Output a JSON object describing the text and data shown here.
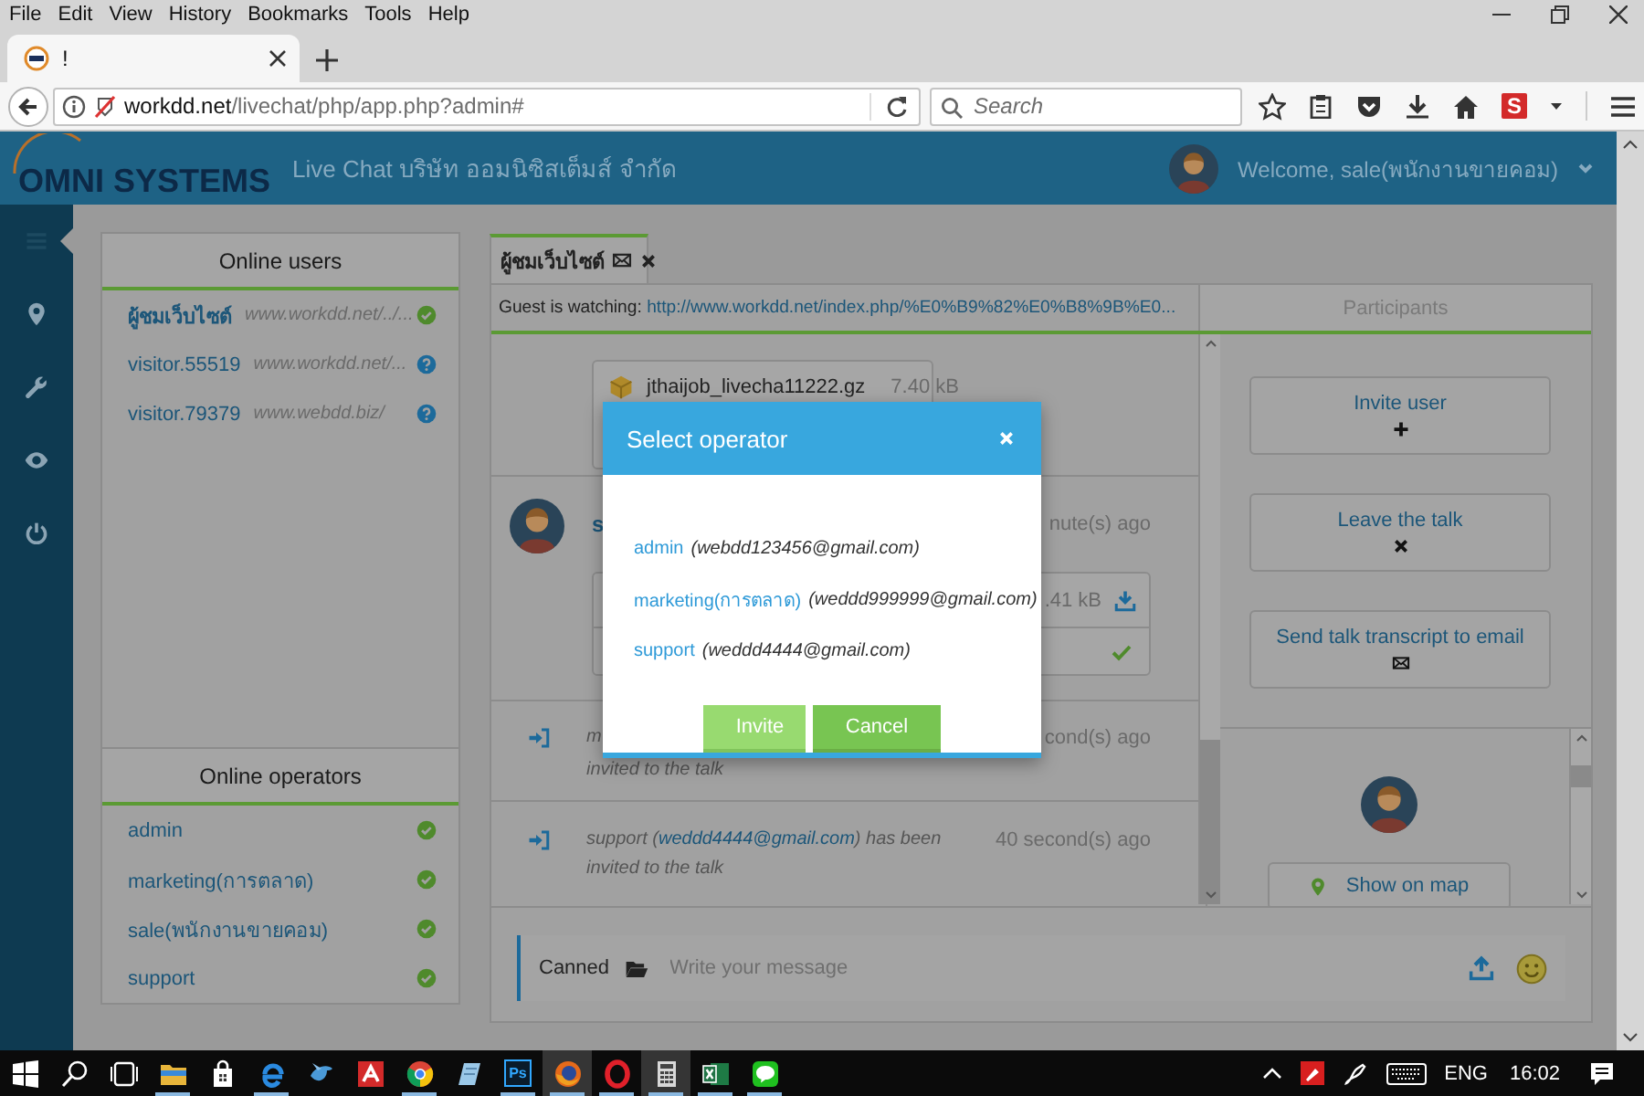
{
  "browser": {
    "menu": [
      "File",
      "Edit",
      "View",
      "History",
      "Bookmarks",
      "Tools",
      "Help"
    ],
    "tab_title": "!",
    "url": {
      "host": "workdd.net",
      "path": "/livechat/php/app.php?admin#"
    },
    "search": {
      "placeholder": "Search"
    },
    "extension_label": "S"
  },
  "header": {
    "logo": "OMNI SYSTEMS",
    "title": "Live Chat บริษัท ออมนิซิสเต็มส์ จำกัด",
    "welcome": "Welcome, sale(พนักงานขายคอม)"
  },
  "sidebar": {
    "items": [
      {
        "kind": "menu",
        "selected": true
      },
      {
        "kind": "pin",
        "selected": false
      },
      {
        "kind": "wrench",
        "selected": false
      },
      {
        "kind": "eye",
        "selected": false
      },
      {
        "kind": "power",
        "selected": false
      }
    ]
  },
  "online_users": {
    "title": "Online users",
    "items": [
      {
        "kind": "online",
        "name": "ผู้ชมเว็บไซต์",
        "page": "www.workdd.net/../...",
        "selected": true
      },
      {
        "kind": "unknown",
        "name": "visitor.55519",
        "page": "www.workdd.net/...",
        "selected": false
      },
      {
        "kind": "unknown",
        "name": "visitor.79379",
        "page": "www.webdd.biz/",
        "selected": false
      }
    ]
  },
  "online_operators": {
    "title": "Online operators",
    "items": [
      {
        "kind": "online",
        "name": "admin"
      },
      {
        "kind": "online",
        "name": "marketing(การตลาด)"
      },
      {
        "kind": "online",
        "name": "sale(พนักงานขายคอม)"
      },
      {
        "kind": "online",
        "name": "support"
      }
    ]
  },
  "chat": {
    "tab": {
      "label": "ผู้ชมเว็บไซต์",
      "selected": true
    },
    "watching": {
      "label": "Guest is watching:",
      "url": "http://www.workdd.net/index.php/%E0%B9%82%E0%B8%9B%E0..."
    },
    "messages": [
      {
        "kind": "file",
        "file": "jthaijob_livecha11222.gz",
        "size": "7.40 kB"
      },
      {
        "kind": "message",
        "author": "s",
        "time": "nute(s) ago",
        "size": ".41 kB",
        "delivered": true
      },
      {
        "kind": "system",
        "text": "m",
        "continued": "invited to the talk",
        "time": "cond(s) ago"
      },
      {
        "kind": "system",
        "text": "support (",
        "link": "weddd4444@gmail.com",
        "after": ") has been invited to the talk",
        "time": "40 second(s) ago"
      }
    ],
    "composer": {
      "canned": "Canned",
      "placeholder": "Write your message"
    }
  },
  "participants": {
    "title": "Participants",
    "actions": [
      {
        "kind": "plus",
        "label": "Invite user"
      },
      {
        "kind": "close",
        "label": "Leave the talk"
      },
      {
        "kind": "mail",
        "label": "Send talk transcript to email"
      }
    ],
    "map_button": "Show on map"
  },
  "dialog": {
    "title": "Select operator",
    "operators": [
      {
        "name": "admin",
        "email": "(webdd123456@gmail.com)"
      },
      {
        "name": "marketing(การตลาด)",
        "email": "(weddd999999@gmail.com)"
      },
      {
        "name": "support",
        "email": "(weddd4444@gmail.com)"
      }
    ],
    "buttons": [
      {
        "label": "Invite",
        "disabled": true
      },
      {
        "label": "Cancel",
        "disabled": false
      }
    ]
  },
  "taskbar": {
    "apps": [
      {
        "kind": "start",
        "running": false,
        "selected": false
      },
      {
        "kind": "search",
        "running": false,
        "selected": false
      },
      {
        "kind": "taskview",
        "running": false,
        "selected": false
      },
      {
        "kind": "folder",
        "running": true,
        "selected": false
      },
      {
        "kind": "store",
        "running": false,
        "selected": false
      },
      {
        "kind": "edge",
        "running": true,
        "selected": false
      },
      {
        "kind": "bird",
        "running": false,
        "selected": false
      },
      {
        "kind": "avira",
        "running": false,
        "selected": false
      },
      {
        "kind": "chrome",
        "running": true,
        "selected": false
      },
      {
        "kind": "notes",
        "running": false,
        "selected": false
      },
      {
        "kind": "ps",
        "label": "Ps",
        "running": true,
        "selected": false
      },
      {
        "kind": "firefox",
        "running": true,
        "selected": true
      },
      {
        "kind": "opera",
        "running": true,
        "selected": false
      },
      {
        "kind": "calc",
        "running": true,
        "selected": true
      },
      {
        "kind": "excel",
        "running": true,
        "selected": false
      },
      {
        "kind": "line",
        "running": true,
        "selected": false
      }
    ],
    "tray": {
      "language": "ENG",
      "time": "16:02"
    }
  }
}
